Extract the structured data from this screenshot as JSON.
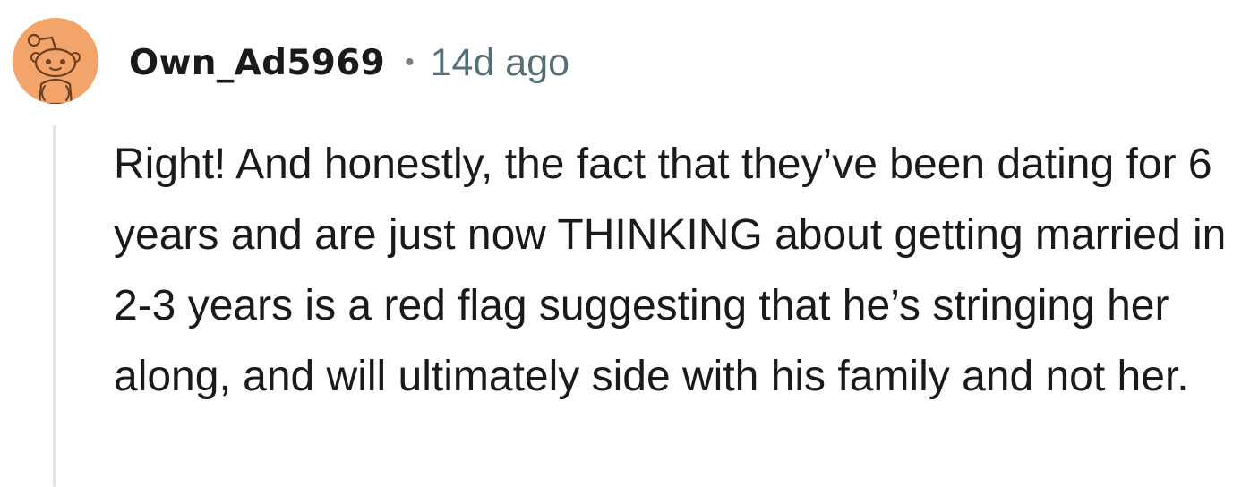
{
  "comment": {
    "author": "Own_Ad5969",
    "separator": "•",
    "timestamp": "14d ago",
    "body": "Right! And honestly, the fact that they’ve been dating for 6 years and are just now THINKING about getting married in 2-3 years is a red flag suggesting that he’s stringing her along, and will ultimately side with his family and not her."
  },
  "avatar": {
    "icon": "snoo-avatar-icon",
    "background_color": "#F2A46A"
  },
  "colors": {
    "text": "#1A1A1B",
    "meta": "#576F76",
    "thread_line": "#E4E4E4"
  }
}
